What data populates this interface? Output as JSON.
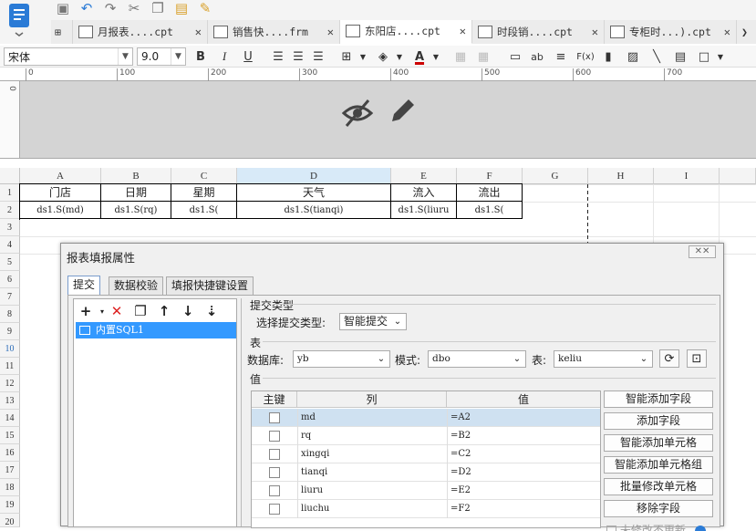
{
  "toolbar": {
    "tabs": [
      {
        "label": "月报表....cpt",
        "active": false
      },
      {
        "label": "销售快....frm",
        "active": false
      },
      {
        "label": "东阳店....cpt",
        "active": true
      },
      {
        "label": "时段销....cpt",
        "active": false
      },
      {
        "label": "专柜时...).cpt",
        "active": false
      }
    ],
    "close_symbol": "✕",
    "overflow_symbol": "❯",
    "menu_symbol": "▾"
  },
  "format": {
    "font_name": "宋体",
    "font_size": "9.0",
    "bold": "B",
    "italic": "I",
    "underline": "U",
    "text_ab": "ab",
    "fx": "F(x)"
  },
  "ruler": [
    "0",
    "100",
    "200",
    "300",
    "400",
    "500",
    "600",
    "700"
  ],
  "vruler_zero": "0",
  "columns": [
    "A",
    "B",
    "C",
    "D",
    "E",
    "F",
    "G",
    "H",
    "I"
  ],
  "rows": [
    "1",
    "2",
    "3",
    "4",
    "5",
    "6",
    "7",
    "8",
    "9",
    "10",
    "11",
    "12",
    "13",
    "14",
    "15",
    "16",
    "17",
    "18",
    "19",
    "20"
  ],
  "header_row": [
    "门店",
    "日期",
    "星期",
    "天气",
    "流入",
    "流出"
  ],
  "data_row": [
    "ds1.S(md)",
    "ds1.S(rq)",
    "ds1.S(",
    "ds1.S(tianqi)",
    "ds1.S(liuru",
    "ds1.S("
  ],
  "dialog": {
    "title": "报表填报属性",
    "close": "✕✕",
    "tabs": [
      "提交",
      "数据校验",
      "填报快捷键设置"
    ],
    "list_item": "内置SQL1",
    "submit_type_group": "提交类型",
    "submit_type_label": "选择提交类型:",
    "submit_type_value": "智能提交",
    "table_group": "表",
    "db_label": "数据库:",
    "db_value": "yb",
    "schema_label": "模式:",
    "schema_value": "dbo",
    "table_label": "表:",
    "table_value": "keliu",
    "value_group": "值",
    "col_headers": [
      "主键",
      "列",
      "值"
    ],
    "fields": [
      {
        "col": "md",
        "val": "=A2"
      },
      {
        "col": "rq",
        "val": "=B2"
      },
      {
        "col": "xingqi",
        "val": "=C2"
      },
      {
        "col": "tianqi",
        "val": "=D2"
      },
      {
        "col": "liuru",
        "val": "=E2"
      },
      {
        "col": "liuchu",
        "val": "=F2"
      }
    ],
    "side_buttons": [
      "智能添加字段",
      "添加字段",
      "智能添加单元格",
      "智能添加单元格组",
      "批量修改单元格",
      "移除字段"
    ],
    "partial_checkbox_label": "未修改不更新"
  }
}
